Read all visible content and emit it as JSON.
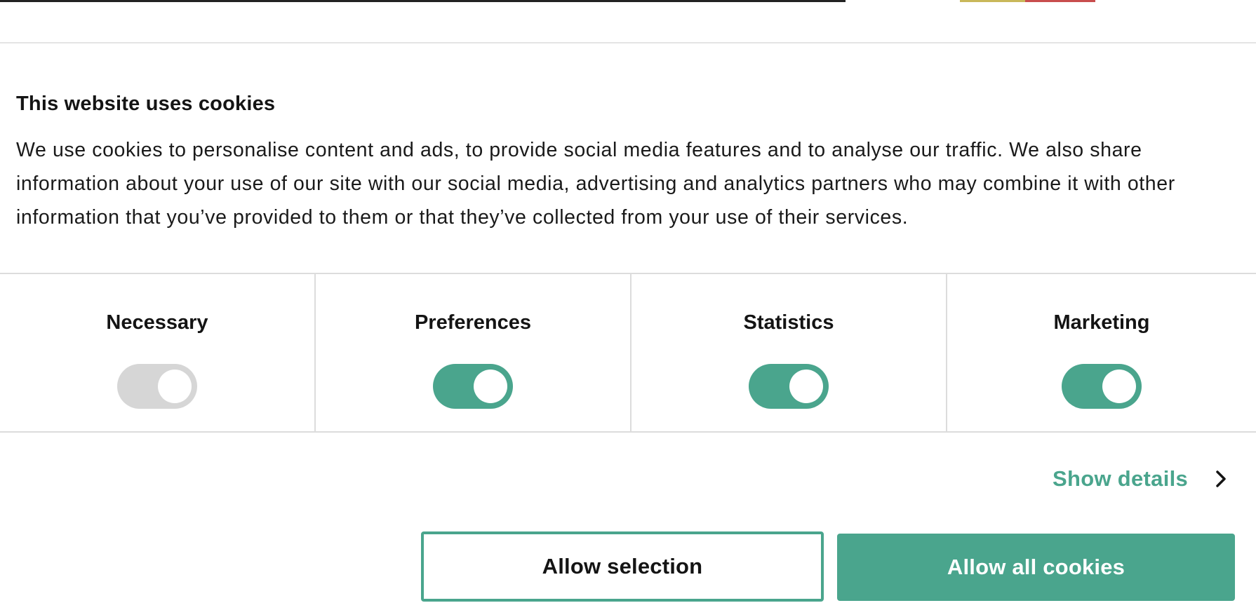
{
  "dialog": {
    "title": "This website uses cookies",
    "body": "We use cookies to personalise content and ads, to provide social media features and to analyse our traffic. We also share information about your use of our site with our social media, advertising and analytics partners who may combine it with other information that you’ve provided to them or that they’ve collected from your use of their services."
  },
  "categories": [
    {
      "label": "Necessary",
      "enabled": true,
      "locked": true
    },
    {
      "label": "Preferences",
      "enabled": true,
      "locked": false
    },
    {
      "label": "Statistics",
      "enabled": true,
      "locked": false
    },
    {
      "label": "Marketing",
      "enabled": true,
      "locked": false
    }
  ],
  "details": {
    "label": "Show details",
    "icon": "chevron-right-icon"
  },
  "buttons": {
    "allow_selection": "Allow selection",
    "allow_all": "Allow all cookies"
  },
  "colors": {
    "accent": "#4aa58d",
    "toggle_disabled": "#d6d6d6",
    "divider": "#dcdcdc",
    "text": "#141414"
  }
}
